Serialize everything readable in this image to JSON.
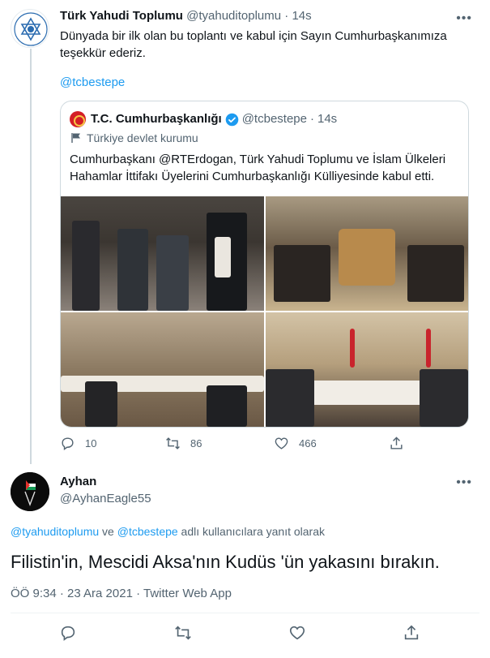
{
  "tweet": {
    "author_name": "Türk Yahudi Toplumu",
    "author_handle": "@tyahuditoplumu",
    "separator": "·",
    "time": "14s",
    "text_line1": "Dünyada bir ilk olan bu toplantı ve kabul için Sayın Cumhurbaşkanımıza",
    "text_line2": "teşekkür ederiz.",
    "mention": "@tcbestepe",
    "replies": "10",
    "retweets": "86",
    "likes": "466"
  },
  "quote": {
    "author_name": "T.C. Cumhurbaşkanlığı",
    "author_handle": "@tcbestepe",
    "separator": "·",
    "time": "14s",
    "label": "Türkiye devlet kurumu",
    "text": "Cumhurbaşkanı @RTErdogan, Türk Yahudi Toplumu ve İslam Ülkeleri Hahamlar İttifakı Üyelerini Cumhurbaşkanlığı Külliyesinde kabul etti."
  },
  "reply": {
    "author_name": "Ayhan",
    "author_handle": "@AyhanEagle55",
    "reply_to_user1": "@tyahuditoplumu",
    "reply_to_and": " ve ",
    "reply_to_user2": "@tcbestepe",
    "reply_to_suffix": " adlı kullanıcılara yanıt olarak",
    "text": "Filistin'in, Mescidi Aksa'nın Kudüs 'ün yakasını bırakın.",
    "meta": "ÖÖ 9:34 · 23 Ara 2021 · Twitter Web App"
  },
  "colors": {
    "accent": "#1d9bf0",
    "muted": "#536471",
    "border": "#cfd9de"
  }
}
